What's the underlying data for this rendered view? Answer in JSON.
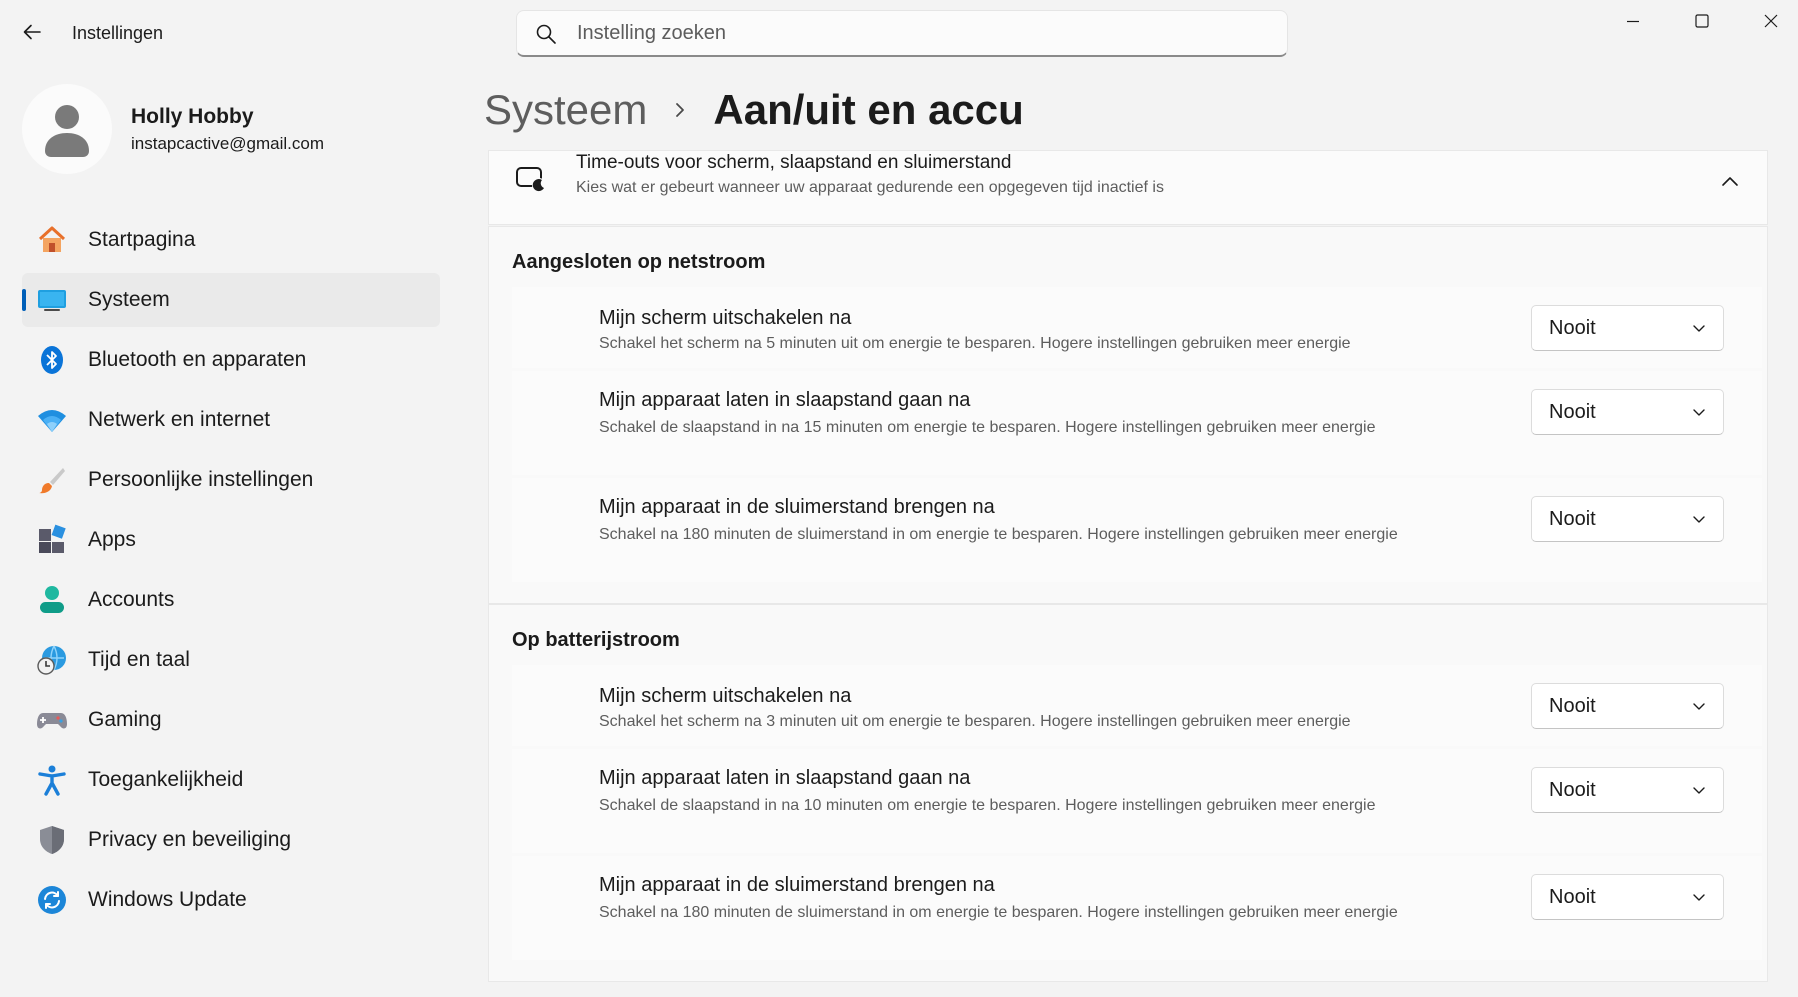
{
  "app": {
    "title": "Instellingen"
  },
  "search": {
    "placeholder": "Instelling zoeken"
  },
  "profile": {
    "name": "Holly Hobby",
    "email": "instapcactive@gmail.com"
  },
  "nav": {
    "items": [
      {
        "label": "Startpagina",
        "icon": "home-icon"
      },
      {
        "label": "Systeem",
        "icon": "system-icon",
        "selected": true
      },
      {
        "label": "Bluetooth en apparaten",
        "icon": "bluetooth-icon"
      },
      {
        "label": "Netwerk en internet",
        "icon": "wifi-icon"
      },
      {
        "label": "Persoonlijke instellingen",
        "icon": "brush-icon"
      },
      {
        "label": "Apps",
        "icon": "apps-icon"
      },
      {
        "label": "Accounts",
        "icon": "account-icon"
      },
      {
        "label": "Tijd en taal",
        "icon": "time-language-icon"
      },
      {
        "label": "Gaming",
        "icon": "gamepad-icon"
      },
      {
        "label": "Toegankelijkheid",
        "icon": "accessibility-icon"
      },
      {
        "label": "Privacy en beveiliging",
        "icon": "shield-icon"
      },
      {
        "label": "Windows Update",
        "icon": "update-icon"
      }
    ]
  },
  "breadcrumb": {
    "parent": "Systeem",
    "current": "Aan/uit en accu"
  },
  "timeouts": {
    "title": "Time-outs voor scherm, slaapstand en sluimerstand",
    "description": "Kies wat er gebeurt wanneer uw apparaat gedurende een opgegeven tijd inactief is",
    "sections": [
      {
        "title": "Aangesloten op netstroom",
        "rows": [
          {
            "title": "Mijn scherm uitschakelen na",
            "description": "Schakel het scherm na 5 minuten uit om energie te besparen. Hogere instellingen gebruiken meer energie",
            "value": "Nooit"
          },
          {
            "title": "Mijn apparaat laten in slaapstand gaan na",
            "description": "Schakel de slaapstand in na 15 minuten om energie te besparen. Hogere instellingen gebruiken meer energie",
            "value": "Nooit"
          },
          {
            "title": "Mijn apparaat in de sluimerstand brengen na",
            "description": "Schakel na 180 minuten de sluimerstand in om energie te besparen. Hogere instellingen gebruiken meer energie",
            "value": "Nooit"
          }
        ]
      },
      {
        "title": "Op batterijstroom",
        "rows": [
          {
            "title": "Mijn scherm uitschakelen na",
            "description": "Schakel het scherm na 3 minuten uit om energie te besparen. Hogere instellingen gebruiken meer energie",
            "value": "Nooit"
          },
          {
            "title": "Mijn apparaat laten in slaapstand gaan na",
            "description": "Schakel de slaapstand in na 10 minuten om energie te besparen. Hogere instellingen gebruiken meer energie",
            "value": "Nooit"
          },
          {
            "title": "Mijn apparaat in de sluimerstand brengen na",
            "description": "Schakel na 180 minuten de sluimerstand in om energie te besparen. Hogere instellingen gebruiken meer energie",
            "value": "Nooit"
          }
        ]
      }
    ]
  },
  "colors": {
    "accent": "#005fb8",
    "background": "#f3f3f3",
    "card": "#fbfbfb"
  }
}
